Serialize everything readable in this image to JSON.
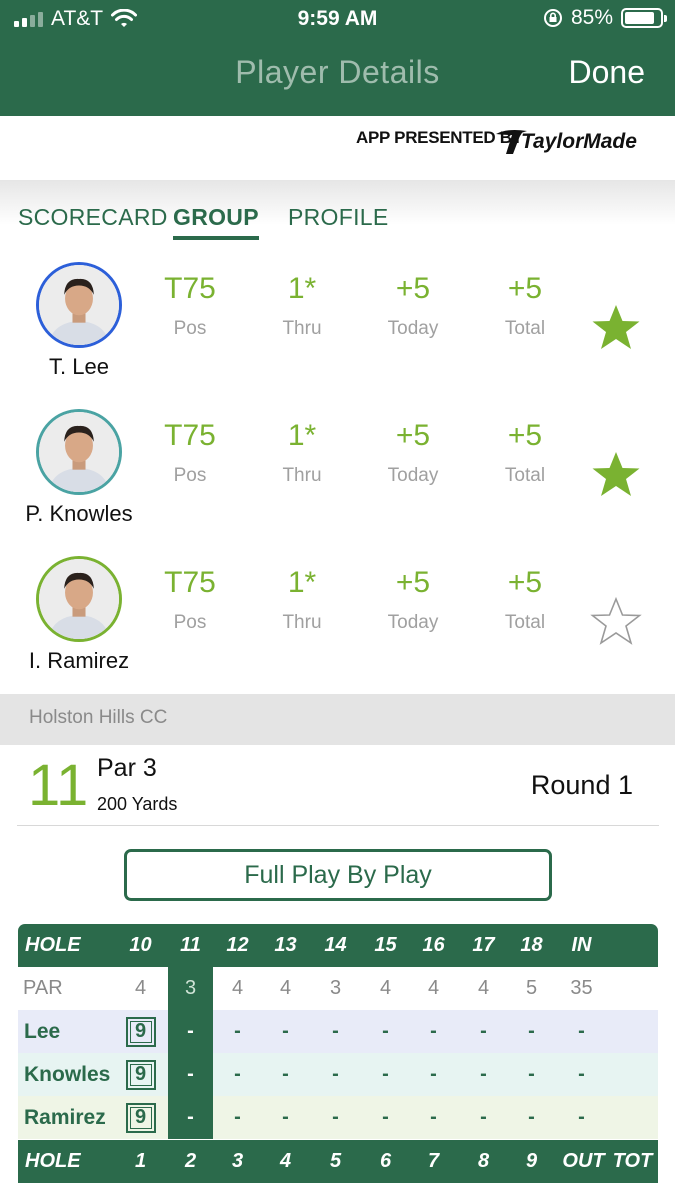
{
  "status_bar": {
    "carrier": "AT&T",
    "time": "9:59 AM",
    "battery": "85%",
    "battery_level": 0.85
  },
  "header": {
    "title": "Player Details",
    "done_label": "Done"
  },
  "sponsor": {
    "text": "APP PRESENTED BY",
    "brand": "TaylorMade"
  },
  "tabs": [
    {
      "label": "SCORECARD",
      "active": false
    },
    {
      "label": "GROUP",
      "active": true
    },
    {
      "label": "PROFILE",
      "active": false
    }
  ],
  "stat_labels": {
    "pos": "Pos",
    "thru": "Thru",
    "today": "Today",
    "total": "Total"
  },
  "players": [
    {
      "name": "T. Lee",
      "pos": "T75",
      "thru": "1*",
      "today": "+5",
      "total": "+5",
      "favorite": true,
      "ring_color": "#2c5fd9"
    },
    {
      "name": "P. Knowles",
      "pos": "T75",
      "thru": "1*",
      "today": "+5",
      "total": "+5",
      "favorite": true,
      "ring_color": "#4aa3a3"
    },
    {
      "name": "I. Ramirez",
      "pos": "T75",
      "thru": "1*",
      "today": "+5",
      "total": "+5",
      "favorite": false,
      "ring_color": "#7ab231"
    }
  ],
  "course": {
    "name": "Holston Hills CC"
  },
  "hole": {
    "number": "11",
    "par": "Par 3",
    "yards": "200 Yards",
    "round": "Round 1"
  },
  "play_by_play_label": "Full Play By Play",
  "scorecard_back": {
    "header": [
      "HOLE",
      "10",
      "11",
      "12",
      "13",
      "14",
      "15",
      "16",
      "17",
      "18",
      "IN"
    ],
    "par": [
      "PAR",
      "4",
      "3",
      "4",
      "4",
      "3",
      "4",
      "4",
      "4",
      "5",
      "35"
    ],
    "rows": [
      {
        "name": "Lee",
        "scores": [
          "9",
          "-",
          "-",
          "-",
          "-",
          "-",
          "-",
          "-",
          "-",
          "-"
        ],
        "bg": "#e8ebf8"
      },
      {
        "name": "Knowles",
        "scores": [
          "9",
          "-",
          "-",
          "-",
          "-",
          "-",
          "-",
          "-",
          "-",
          "-"
        ],
        "bg": "#e7f4f2"
      },
      {
        "name": "Ramirez",
        "scores": [
          "9",
          "-",
          "-",
          "-",
          "-",
          "-",
          "-",
          "-",
          "-",
          "-"
        ],
        "bg": "#eff5e6"
      }
    ]
  },
  "scorecard_front": {
    "header": [
      "HOLE",
      "1",
      "2",
      "3",
      "4",
      "5",
      "6",
      "7",
      "8",
      "9",
      "OUT",
      "TOT"
    ]
  },
  "colors": {
    "brand_green": "#2b6a4b",
    "accent_green": "#7ab231",
    "muted": "#a0a0a0"
  }
}
